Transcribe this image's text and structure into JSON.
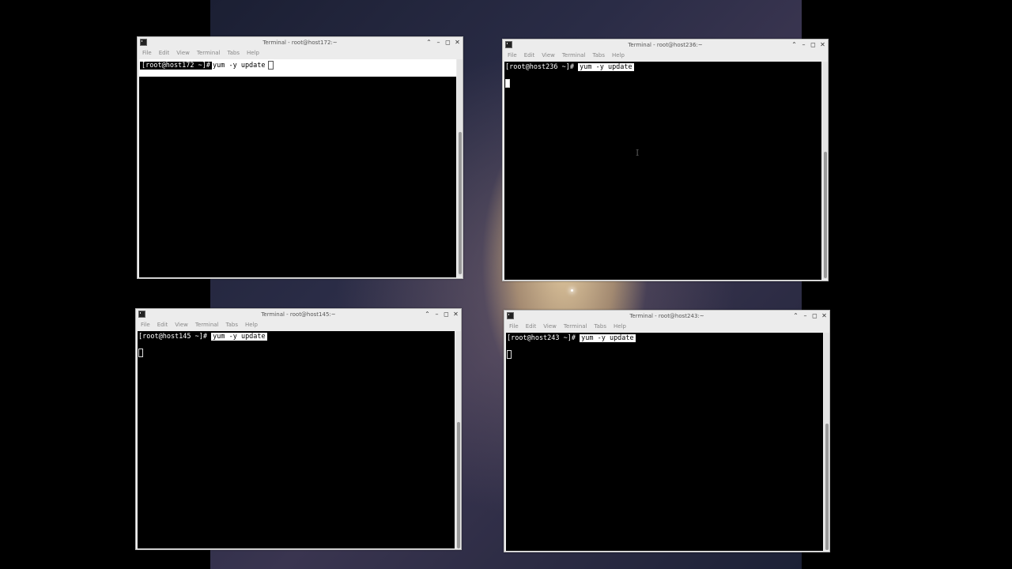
{
  "menu": [
    "File",
    "Edit",
    "View",
    "Terminal",
    "Tabs",
    "Help"
  ],
  "window_controls": {
    "minimize": "⌃",
    "restore": "–",
    "maximize": "◻",
    "close": "✕"
  },
  "windows": [
    {
      "title": "Terminal - root@host172:~",
      "prompt": "[root@host172 ~]#",
      "command": "yum -y update"
    },
    {
      "title": "Terminal - root@host236:~",
      "prompt": "[root@host236 ~]#",
      "command": "yum -y update"
    },
    {
      "title": "Terminal - root@host145:~",
      "prompt": "[root@host145 ~]#",
      "command": "yum -y update"
    },
    {
      "title": "Terminal - root@host243:~",
      "prompt": "[root@host243 ~]#",
      "command": "yum -y update"
    }
  ],
  "icons": {
    "app": "terminal-icon",
    "pointer": "i-beam-cursor-icon"
  }
}
